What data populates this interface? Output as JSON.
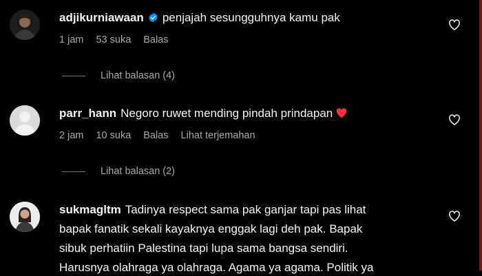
{
  "comments": [
    {
      "username": "adjikurniawaan",
      "verified": true,
      "text": "penjajah sesungguhnya kamu pak",
      "time": "1 jam",
      "likes": "53 suka",
      "reply_label": "Balas",
      "view_replies": "Lihat balasan (4)"
    },
    {
      "username": "parr_hann",
      "text": "Negoro ruwet mending pindah prindapan",
      "emoji": "red-heart-emoji",
      "time": "2 jam",
      "likes": "10 suka",
      "reply_label": "Balas",
      "translate_label": "Lihat terjemahan",
      "view_replies": "Lihat balasan (2)"
    },
    {
      "username": "sukmagltm",
      "text_lines": [
        "Tadinya respect sama pak ganjar tapi pas lihat",
        "bapak fanatik sekali kayaknya enggak lagi deh pak. Bapak",
        "sibuk perhatiin Palestina tapi lupa sama bangsa sendiri.",
        "Harusnya olahraga ya olahraga. Agama ya agama. Politik ya"
      ]
    }
  ],
  "colors": {
    "background": "#000000",
    "text": "#f5f5f5",
    "secondary": "#a8a8a8",
    "verified": "#0095f6",
    "heart": "#ff3040"
  }
}
